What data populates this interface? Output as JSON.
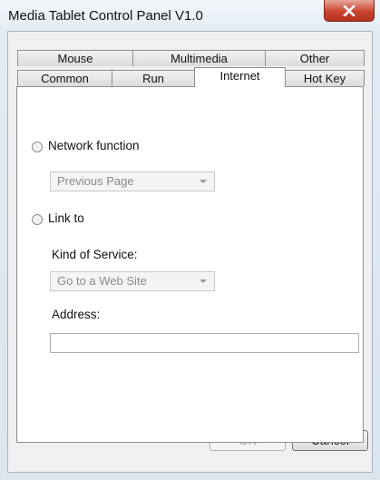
{
  "window": {
    "title": "Media Tablet Control Panel V1.0"
  },
  "tabs": {
    "row_back": [
      {
        "label": "Mouse"
      },
      {
        "label": "Multimedia"
      },
      {
        "label": "Other"
      }
    ],
    "row_front": [
      {
        "label": "Common"
      },
      {
        "label": "Run"
      },
      {
        "label": "Internet",
        "selected": true
      },
      {
        "label": "Hot Key"
      }
    ]
  },
  "internet": {
    "network_function": {
      "label": "Network function",
      "selected": false,
      "value": "Previous Page"
    },
    "link_to": {
      "label": "Link to",
      "selected": false,
      "kind_label": "Kind of Service:",
      "kind_value": "Go to a Web Site",
      "address_label": "Address:",
      "address_value": ""
    }
  },
  "buttons": {
    "ok": "OK",
    "cancel": "Cancel"
  }
}
